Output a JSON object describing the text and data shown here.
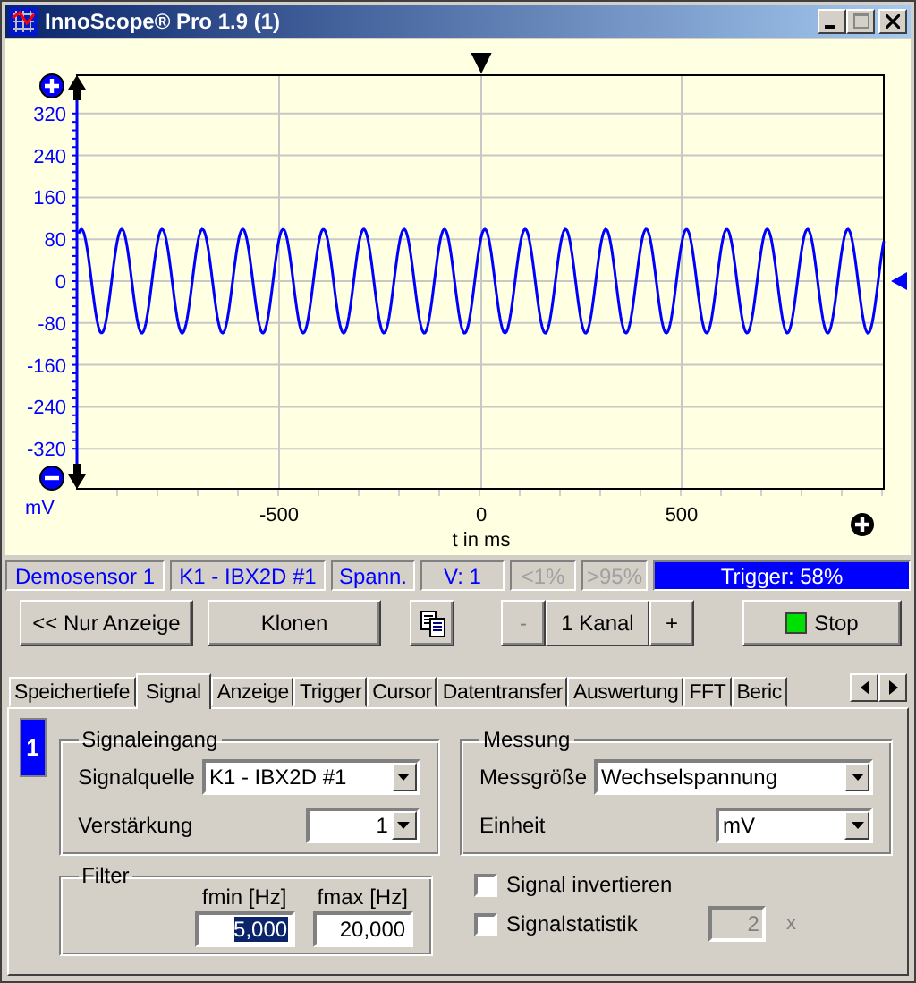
{
  "window": {
    "title": "InnoScope® Pro 1.9 (1)"
  },
  "plot": {
    "y_unit": "mV",
    "y_ticks": [
      "320",
      "240",
      "160",
      "80",
      "0",
      "-80",
      "-160",
      "-240",
      "-320"
    ],
    "x_ticks": [
      "-500",
      "0",
      "500"
    ],
    "x_label": "t in ms"
  },
  "status_bar": [
    {
      "text": "Demosensor 1",
      "disabled": false
    },
    {
      "text": "K1 - IBX2D #1",
      "disabled": false
    },
    {
      "text": "Spann.",
      "disabled": false
    },
    {
      "text": "V: 1",
      "disabled": false
    },
    {
      "text": "<1%",
      "disabled": true
    },
    {
      "text": ">95%",
      "disabled": true
    }
  ],
  "trigger_status": "Trigger: 58%",
  "toolbar": {
    "display_only": "<< Nur Anzeige",
    "clone": "Klonen",
    "channel_minus": {
      "label": "-",
      "disabled": true
    },
    "channels": "1 Kanal",
    "channel_plus": {
      "label": "+",
      "disabled": false
    },
    "stop": {
      "label": "Stop",
      "running": true
    }
  },
  "tabs": [
    {
      "label": "Speichertiefe",
      "selected": false
    },
    {
      "label": "Signal",
      "selected": true
    },
    {
      "label": "Anzeige",
      "selected": false
    },
    {
      "label": "Trigger",
      "selected": false
    },
    {
      "label": "Cursor",
      "selected": false
    },
    {
      "label": "Datentransfer",
      "selected": false
    },
    {
      "label": "Auswertung",
      "selected": false
    },
    {
      "label": "FFT",
      "selected": false
    },
    {
      "label": "Beric",
      "selected": false
    }
  ],
  "channel_badge": "1",
  "signal_input": {
    "title": "Signaleingang",
    "source_label": "Signalquelle",
    "source": "K1 - IBX2D #1",
    "gain_label": "Verstärkung",
    "gain": "1"
  },
  "measurement": {
    "title": "Messung",
    "quantity_label": "Messgröße",
    "quantity": "Wechselspannung",
    "unit_label": "Einheit",
    "unit": "mV"
  },
  "filter": {
    "title": "Filter",
    "fmin_label": "fmin [Hz]",
    "fmin": "5,000",
    "fmax_label": "fmax [Hz]",
    "fmax": "20,000"
  },
  "options": [
    {
      "label": "Signal invertieren",
      "checked": false
    },
    {
      "label": "Signalstatistik",
      "checked": false
    }
  ],
  "statistics_count": {
    "value": "2",
    "disabled": true,
    "suffix": "x"
  }
}
